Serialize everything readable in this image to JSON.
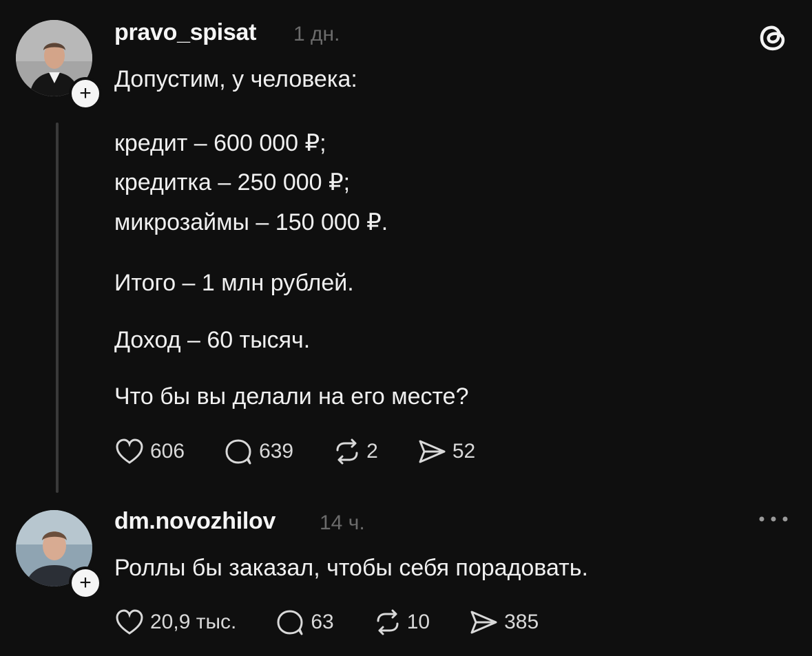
{
  "post": {
    "username": "pravo_spisat",
    "time": "1 дн.",
    "lines": [
      "Допустим, у человека:",
      "кредит – 600 000 ₽;",
      "кредитка – 250 000 ₽;",
      "микрозаймы – 150 000 ₽.",
      "Итого – 1 млн рублей.",
      "Доход – 60 тысяч.",
      "Что бы вы делали на его месте?"
    ],
    "likes": "606",
    "replies": "639",
    "reposts": "2",
    "shares": "52"
  },
  "reply": {
    "username": "dm.novozhilov",
    "time": "14 ч.",
    "text": "Роллы бы заказал, чтобы себя порадовать.",
    "likes": "20,9 тыс.",
    "replies": "63",
    "reposts": "10",
    "shares": "385"
  },
  "plus_glyph": "+",
  "icons": [
    "threads-logo-icon",
    "heart-icon",
    "comment-icon",
    "repost-icon",
    "share-icon",
    "more-icon"
  ]
}
